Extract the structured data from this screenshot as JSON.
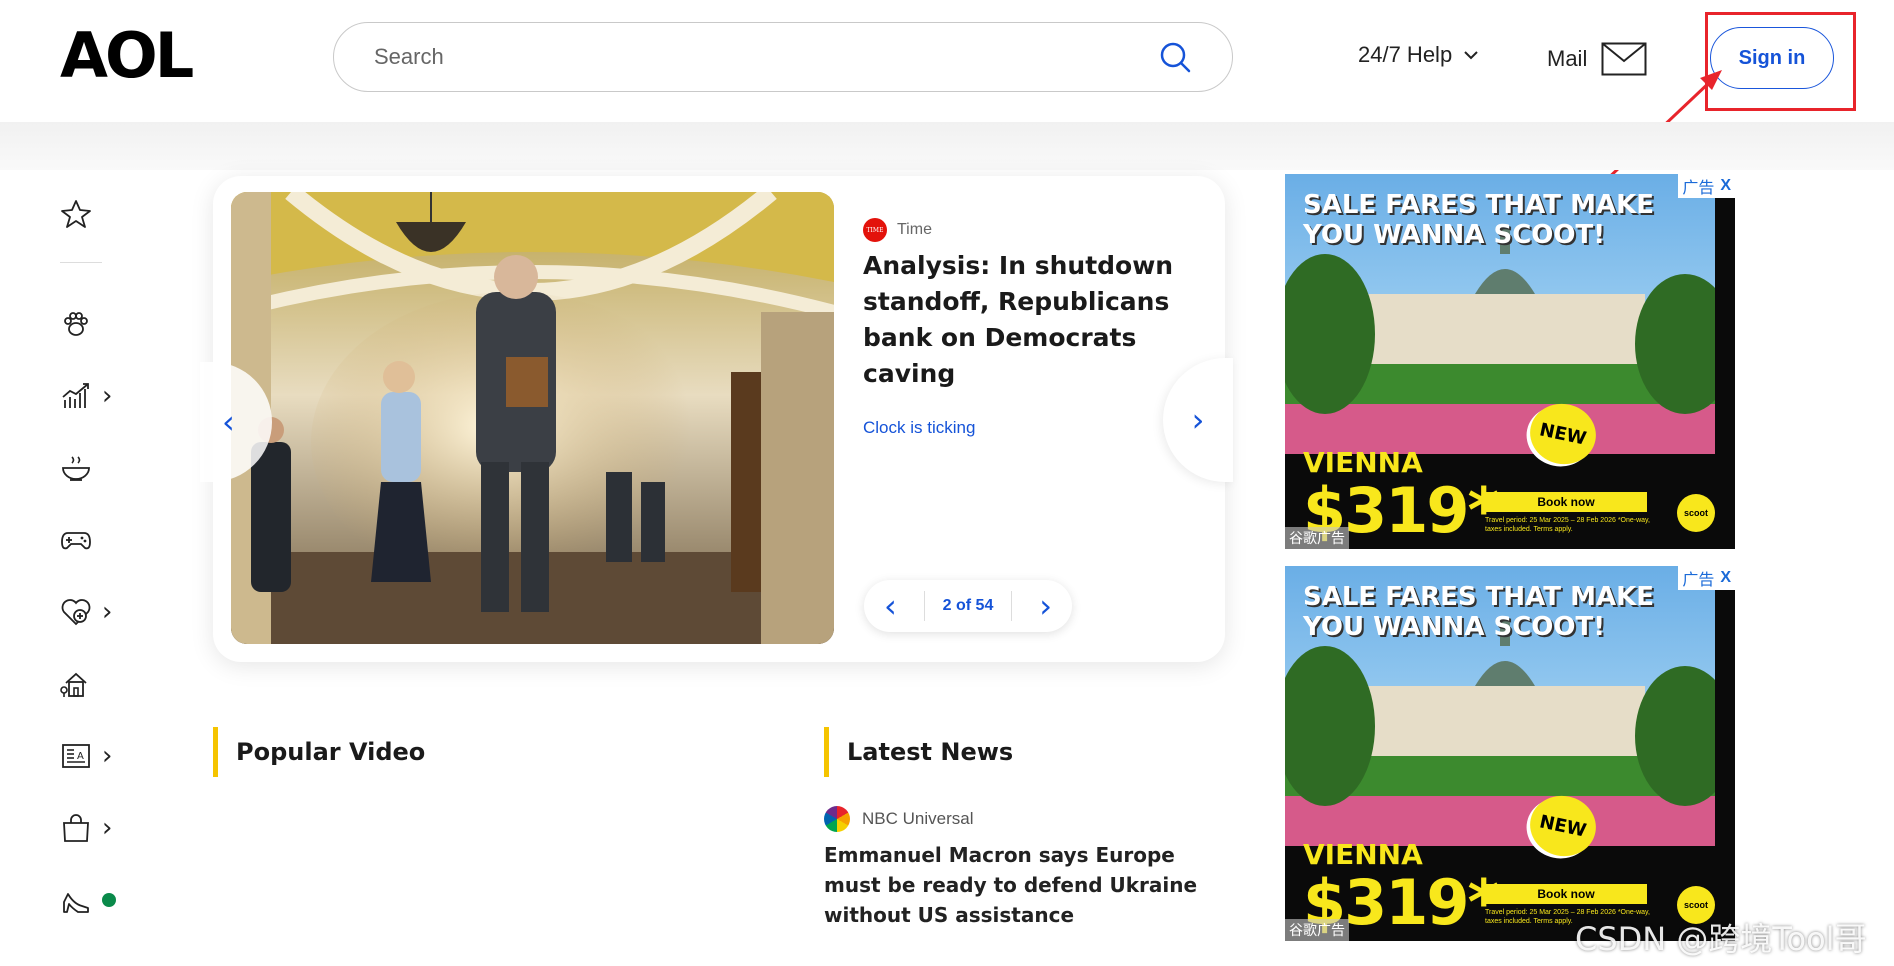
{
  "header": {
    "logo": "AOL",
    "search_placeholder": "Search",
    "help_label": "24/7 Help",
    "mail_label": "Mail",
    "signin_label": "Sign in"
  },
  "sidebar": {
    "items": [
      {
        "icon": "star-icon"
      },
      {
        "icon": "paw-icon"
      },
      {
        "icon": "finance-chart-icon",
        "has_submenu": true
      },
      {
        "icon": "food-bowl-icon"
      },
      {
        "icon": "gamepad-icon"
      },
      {
        "icon": "health-heart-icon",
        "has_submenu": true
      },
      {
        "icon": "home-icon"
      },
      {
        "icon": "news-icon",
        "has_submenu": true
      },
      {
        "icon": "shopping-bag-icon",
        "has_submenu": true
      },
      {
        "icon": "high-heel-icon",
        "status_dot": "#0a8a4a"
      }
    ]
  },
  "carousel": {
    "source": "Time",
    "source_logo": "TIME",
    "headline": "Analysis: In shutdown standoff, Republicans bank on Democrats caving",
    "subhead": "Clock is ticking",
    "counter": "2 of 54"
  },
  "sections": {
    "popular_video": "Popular Video",
    "latest_news": "Latest News"
  },
  "latest_news": {
    "source": "NBC Universal",
    "headline": "Emmanuel Macron says Europe must be ready to defend Ukraine without US assistance"
  },
  "ads": [
    {
      "label": "广告",
      "close": "X",
      "headline": "SALE FARES THAT MAKE YOU WANNA SCOOT!",
      "city": "VIENNA",
      "price": "$319*",
      "badge": "NEW",
      "cta": "Book now",
      "fine_print": "Travel period: 25 Mar 2025 – 28 Feb 2026 *One-way, taxes included. Terms apply.",
      "brand": "scoot",
      "bottom_label": "谷歌广告"
    },
    {
      "label": "广告",
      "close": "X",
      "headline": "SALE FARES THAT MAKE YOU WANNA SCOOT!",
      "city": "VIENNA",
      "price": "$319*",
      "badge": "NEW",
      "cta": "Book now",
      "fine_print": "Travel period: 25 Mar 2025 – 28 Feb 2026 *One-way, taxes included. Terms apply.",
      "brand": "scoot",
      "bottom_label": "谷歌广告"
    }
  ],
  "watermark": "CSDN @跨境Tool哥",
  "colors": {
    "accent_blue": "#1553d8",
    "highlight_red": "#e8242b",
    "section_bar": "#f5c400",
    "ad_yellow": "#f8e71c"
  }
}
